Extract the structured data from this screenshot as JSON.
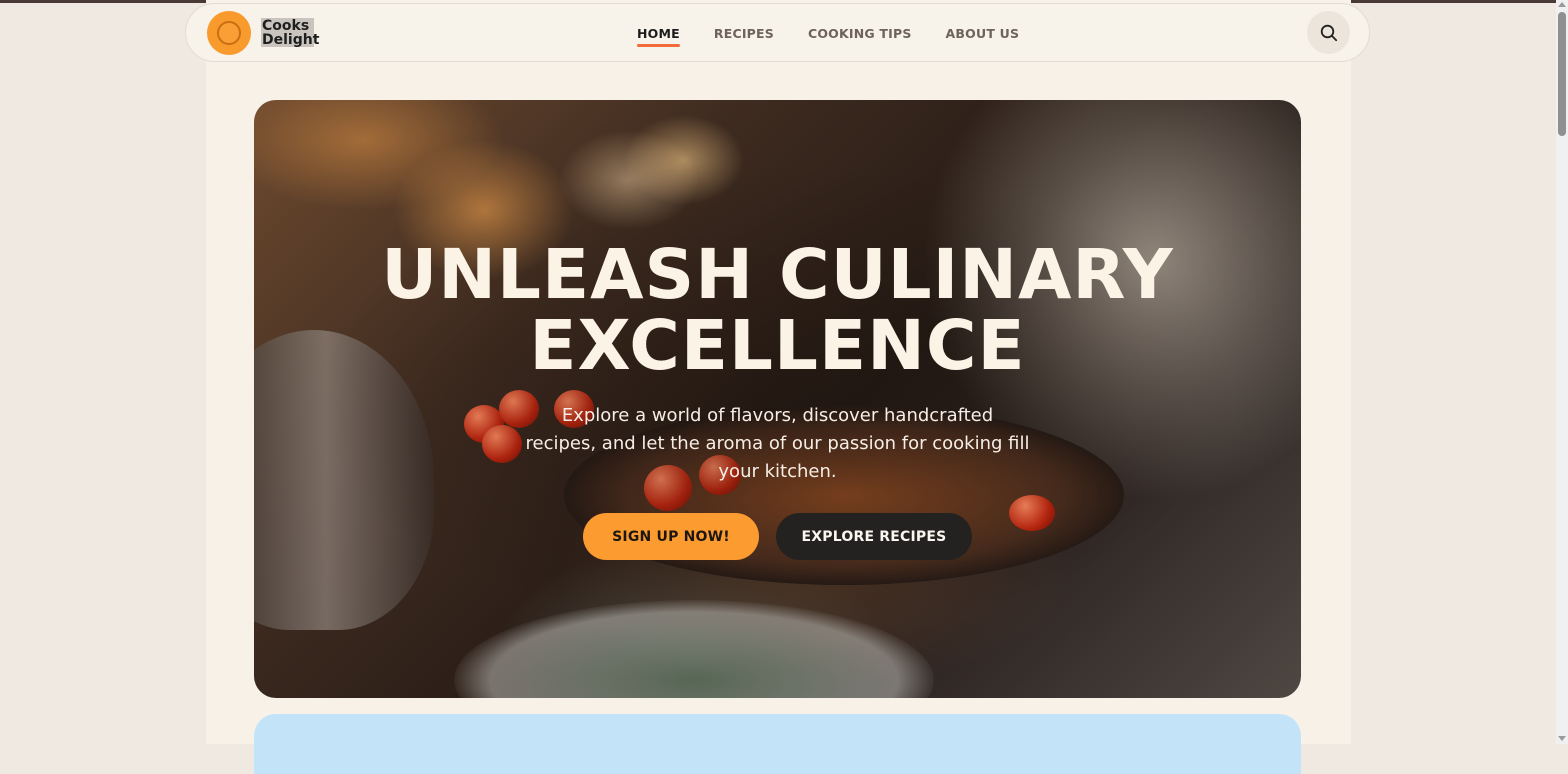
{
  "brand": {
    "name_line1": "Cooks",
    "name_line2": "Delight",
    "logo_icon": "circle-logo-icon",
    "accent_color": "#f89a2c"
  },
  "nav": {
    "items": [
      {
        "label": "HOME",
        "active": true
      },
      {
        "label": "RECIPES",
        "active": false
      },
      {
        "label": "COOKING TIPS",
        "active": false
      },
      {
        "label": "ABOUT US",
        "active": false
      }
    ],
    "active_underline_color": "#f26b3a",
    "search_icon": "search-icon"
  },
  "hero": {
    "title_line1": "UNLEASH CULINARY",
    "title_line2": "EXCELLENCE",
    "subtitle": "Explore a world of flavors, discover handcrafted recipes, and let the aroma of our passion for cooking fill your kitchen.",
    "primary_button": "SIGN UP NOW!",
    "secondary_button": "EXPLORE RECIPES",
    "primary_color": "#fc9b2f",
    "secondary_color": "#242220"
  },
  "next_section": {
    "color": "#c3e3f8"
  }
}
